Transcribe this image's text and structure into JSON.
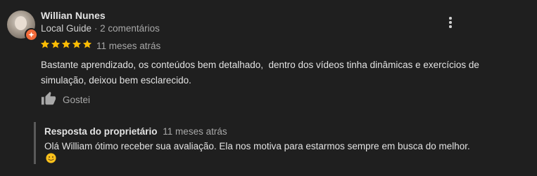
{
  "reviewer": {
    "name": "Willian Nunes",
    "badge": "Local Guide",
    "meta_separator": " · ",
    "comment_count": "2 comentários"
  },
  "review": {
    "rating": 5,
    "rating_max": 5,
    "time": "11 meses atrás",
    "text": "Bastante aprendizado, os conteúdos bem detalhado,  dentro dos vídeos tinha dinâmicas e exercícios de simulação, deixou bem esclarecido."
  },
  "actions": {
    "like_label": "Gostei"
  },
  "owner_reply": {
    "author": "Resposta do proprietário",
    "time": "11 meses atrás",
    "text": "Olá William ótimo receber sua avaliação. Ela nos motiva para estarmos sempre em busca do melhor."
  },
  "colors": {
    "background": "#1f1f1f",
    "star": "#fbbc04",
    "guide_badge": "#f26b3a",
    "reply_border": "#5a5a5a"
  },
  "icons": {
    "more": "more-vert-icon",
    "like": "thumb-up-icon",
    "emoji": "smiling-face-emoji",
    "star": "star-icon",
    "guide": "local-guide-badge-icon"
  }
}
